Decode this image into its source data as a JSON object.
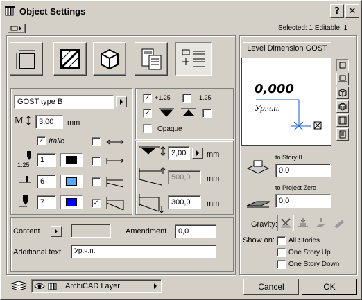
{
  "window": {
    "title": "Object Settings",
    "help_glyph": "?",
    "close_glyph": "✕"
  },
  "topbar": {
    "selection_status": "Selected: 1 Editable: 1"
  },
  "type_select": {
    "value": "GOST type B"
  },
  "size": {
    "label_icon": "M",
    "value": "3,00",
    "unit": "mm"
  },
  "italic": {
    "label": "Italic",
    "checked": true
  },
  "pens": [
    {
      "num_label": "1.25",
      "value": "1",
      "color": "#000000"
    },
    {
      "num_label": "",
      "value": "6",
      "color": "#55aaff"
    },
    {
      "num_label": "",
      "value": "7",
      "color": "#0000ff"
    }
  ],
  "marker": {
    "row1": {
      "check_a": true,
      "a_label": "+1.25",
      "check_b": false,
      "b_label": "1.25"
    },
    "row2": {
      "check_a": true,
      "check_b": false
    }
  },
  "opaque": {
    "label": "Opaque",
    "checked": false
  },
  "offsets": {
    "v1": "2,00",
    "v2": "500,0",
    "v3": "300,0",
    "unit": "mm"
  },
  "content": {
    "label": "Content",
    "amendment_label": "Amendment",
    "amendment_value": "0,0",
    "additional_label": "Additional text",
    "additional_value": "Ур.ч.п."
  },
  "preview": {
    "tab": "Level Dimension GOST",
    "value_text": "0,000",
    "sub_text": "Ур.ч.п."
  },
  "story": {
    "to_story_label": "to Story 0",
    "to_story_value": "0,0",
    "to_project_label": "to Project Zero",
    "to_project_value": "0,0"
  },
  "gravity": {
    "label": "Gravity:"
  },
  "show_on": {
    "label": "Show on:",
    "options": [
      {
        "label": "All Stories",
        "checked": false
      },
      {
        "label": "One Story Up",
        "checked": false
      },
      {
        "label": "One Story Down",
        "checked": false
      }
    ]
  },
  "layer": {
    "value": "ArchiCAD Layer"
  },
  "buttons": {
    "cancel": "Cancel",
    "ok": "OK"
  }
}
